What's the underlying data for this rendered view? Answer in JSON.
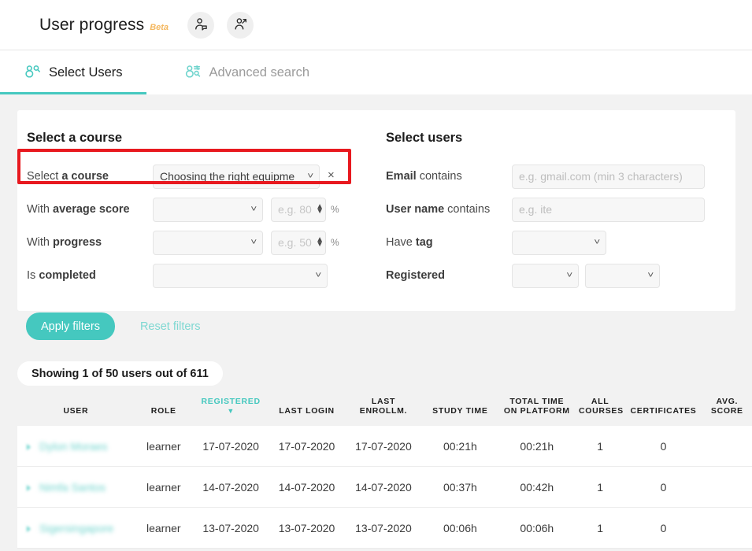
{
  "header": {
    "title": "User progress",
    "beta_label": "Beta",
    "icon_button_1": "user-tag-icon",
    "icon_button_2": "user-progress-icon"
  },
  "tabs": [
    {
      "label": "Select Users",
      "icon": "user-search-icon",
      "active": true
    },
    {
      "label": "Advanced search",
      "icon": "user-filter-search-icon",
      "active": false
    }
  ],
  "filters": {
    "course_section": {
      "title": "Select a course",
      "rows": [
        {
          "label_plain": "Select ",
          "label_bold": "a course",
          "select_value": "Choosing the right equipme",
          "clear_label": "×"
        },
        {
          "label_plain": "With ",
          "label_bold": "average score",
          "select_value": "",
          "number_placeholder": "e.g. 80",
          "unit": "%"
        },
        {
          "label_plain": "With ",
          "label_bold": "progress",
          "select_value": "",
          "number_placeholder": "e.g. 50",
          "unit": "%"
        },
        {
          "label_plain": "Is ",
          "label_bold": "completed",
          "select_value": ""
        }
      ]
    },
    "users_section": {
      "title": "Select users",
      "rows": [
        {
          "label_plain": "",
          "label_bold": "Email",
          "label_suffix": " contains",
          "input_value": "",
          "placeholder": "e.g. gmail.com (min 3 characters)"
        },
        {
          "label_plain": "",
          "label_bold": "User name",
          "label_suffix": " contains",
          "input_value": "",
          "placeholder": "e.g. ite"
        },
        {
          "label_plain": "Have ",
          "label_bold": "tag",
          "label_suffix": "",
          "select_value": ""
        },
        {
          "label_plain": "",
          "label_bold": "Registered",
          "label_suffix": "",
          "select_value": "",
          "select_value_2": ""
        }
      ]
    },
    "apply_label": "Apply filters",
    "reset_label": "Reset filters"
  },
  "results": {
    "showing_text": "Showing 1 of 50 users out of 611"
  },
  "table": {
    "columns": [
      {
        "label": "USER",
        "sorted": false
      },
      {
        "label": "ROLE",
        "sorted": false
      },
      {
        "label": "REGISTERED",
        "sorted": true,
        "sort_arrow": "▼"
      },
      {
        "label": "LAST LOGIN",
        "sorted": false
      },
      {
        "label": "LAST\nENROLLM.",
        "sorted": false
      },
      {
        "label": "STUDY TIME",
        "sorted": false
      },
      {
        "label": "TOTAL TIME\nON PLATFORM",
        "sorted": false
      },
      {
        "label": "ALL\nCOURSES",
        "sorted": false
      },
      {
        "label": "CERTIFICATES",
        "sorted": false
      },
      {
        "label": "AVG.\nSCORE",
        "sorted": false
      }
    ],
    "rows": [
      {
        "user": "Dylon Moraes",
        "role": "learner",
        "registered": "17-07-2020",
        "last_login": "17-07-2020",
        "last_enrollment": "17-07-2020",
        "study_time": "00:21h",
        "total_time": "00:21h",
        "all_courses": "1",
        "certificates": "0",
        "avg_score": ""
      },
      {
        "user": "Nimfa Santos",
        "role": "learner",
        "registered": "14-07-2020",
        "last_login": "14-07-2020",
        "last_enrollment": "14-07-2020",
        "study_time": "00:37h",
        "total_time": "00:42h",
        "all_courses": "1",
        "certificates": "0",
        "avg_score": ""
      },
      {
        "user": "Sigersingapore",
        "role": "learner",
        "registered": "13-07-2020",
        "last_login": "13-07-2020",
        "last_enrollment": "13-07-2020",
        "study_time": "00:06h",
        "total_time": "00:06h",
        "all_courses": "1",
        "certificates": "0",
        "avg_score": ""
      }
    ]
  },
  "colors": {
    "accent": "#45c8bf",
    "beta": "#f4b860",
    "highlight_box": "#e8191f",
    "page_bg": "#f2f2f2"
  }
}
